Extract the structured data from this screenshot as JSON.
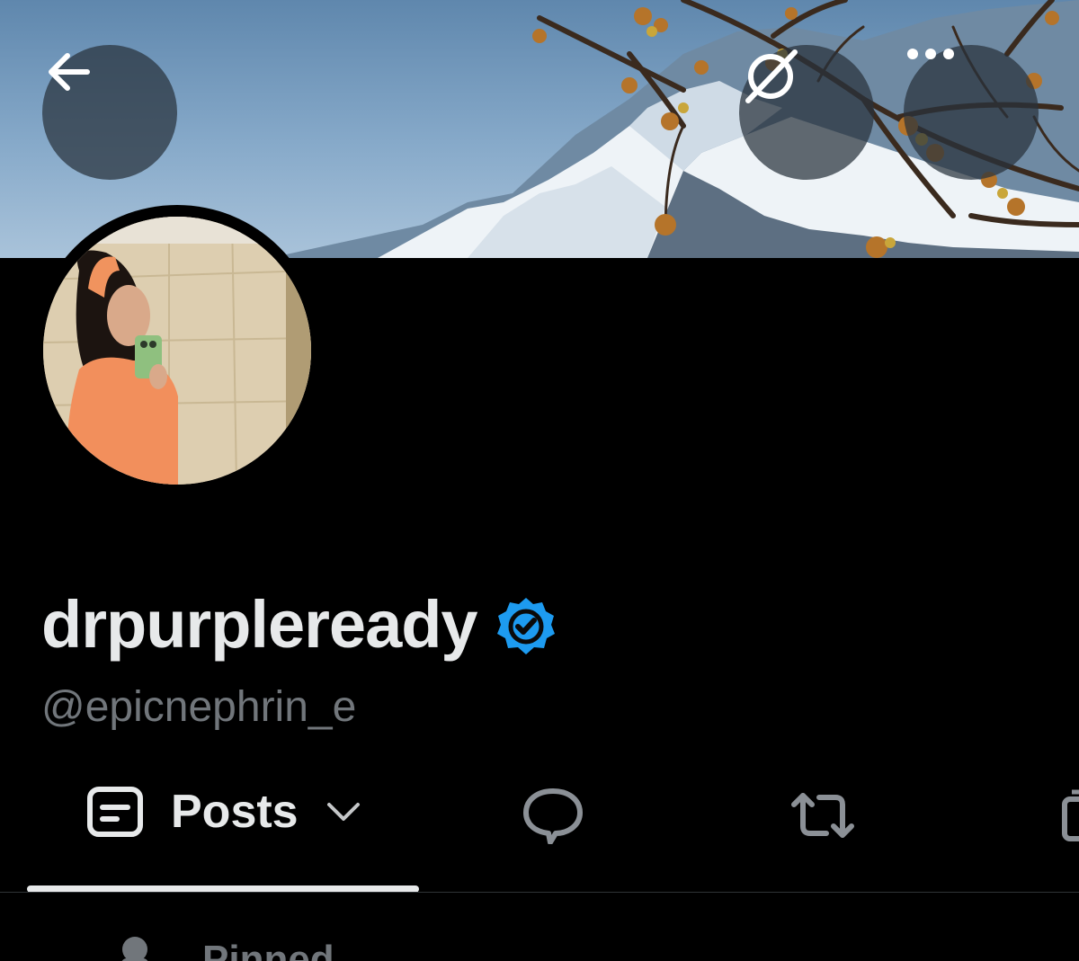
{
  "header": {
    "back_icon": "arrow-left-icon",
    "grok_icon": "grok-icon",
    "more_icon": "more-horizontal-icon"
  },
  "profile": {
    "display_name": "drpurpleready",
    "handle": "@epicnephrin_e",
    "verified": true,
    "verified_color": "#1d9bf0"
  },
  "tabs": {
    "posts_label": "Posts",
    "items": [
      {
        "icon": "posts-icon",
        "label": "Posts",
        "selected": true
      },
      {
        "icon": "reply-icon",
        "selected": false
      },
      {
        "icon": "repost-icon",
        "selected": false
      },
      {
        "icon": "media-icon",
        "selected": false
      }
    ]
  },
  "pinned": {
    "label": "Pinned",
    "icon": "pin-icon"
  }
}
